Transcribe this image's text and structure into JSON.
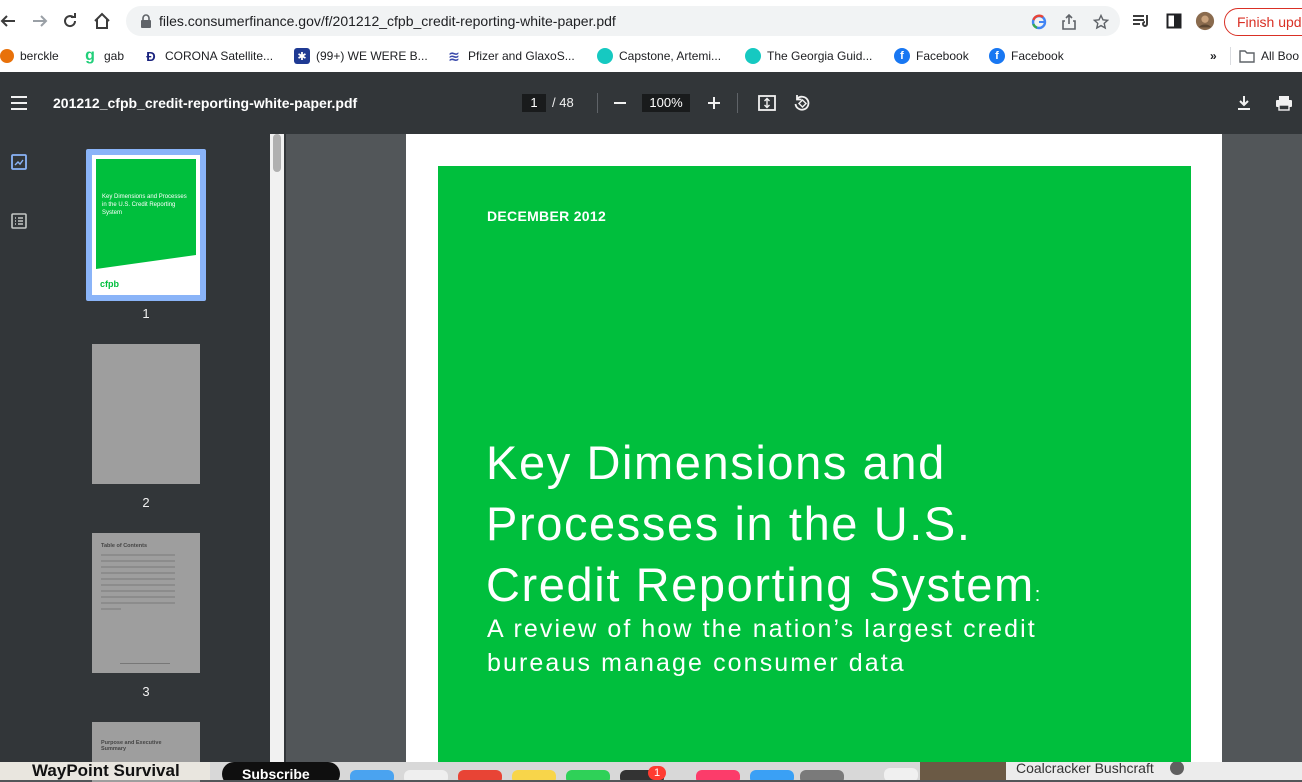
{
  "browser": {
    "url": "files.consumerfinance.gov/f/201212_cfpb_credit-reporting-white-paper.pdf",
    "finish_update": "Finish upda"
  },
  "bookmarks": [
    {
      "label": "berckle"
    },
    {
      "label": "gab"
    },
    {
      "label": "CORONA Satellite..."
    },
    {
      "label": "(99+) WE WERE B..."
    },
    {
      "label": "Pfizer and GlaxoS..."
    },
    {
      "label": "Capstone, Artemi..."
    },
    {
      "label": "The Georgia Guid..."
    },
    {
      "label": "Facebook"
    },
    {
      "label": "Facebook"
    }
  ],
  "bookmarks_more": "»",
  "bookmarks_folder": "All Boo",
  "pdf": {
    "title": "201212_cfpb_credit-reporting-white-paper.pdf",
    "current_page": "1",
    "page_count": "/ 48",
    "zoom": "100%"
  },
  "thumbnails": [
    {
      "num": "1",
      "title": "Key Dimensions and Processes in the U.S. Credit Reporting System",
      "logo": "cfpb"
    },
    {
      "num": "2"
    },
    {
      "num": "3",
      "heading": "Table of Contents"
    },
    {
      "heading": "Purpose and Executive Summary"
    }
  ],
  "cover": {
    "date": "DECEMBER 2012",
    "title_line1": "Key Dimensions and",
    "title_line2": "Processes in the U.S.",
    "title_line3": "Credit Reporting System",
    "title_colon": ":",
    "subtitle_line1": "A review of how the nation’s largest credit",
    "subtitle_line2": "bureaus manage consumer data"
  },
  "taskbar": {
    "left_text": "WayPoint Survival",
    "subscribe": "Subscribe",
    "right_text": "Coalcracker Bushcraft",
    "badge": "1"
  },
  "colors": {
    "cover_green": "#00bf3d",
    "toolbar": "#323639",
    "viewer_bg": "#525659",
    "accent_red": "#d93025"
  }
}
